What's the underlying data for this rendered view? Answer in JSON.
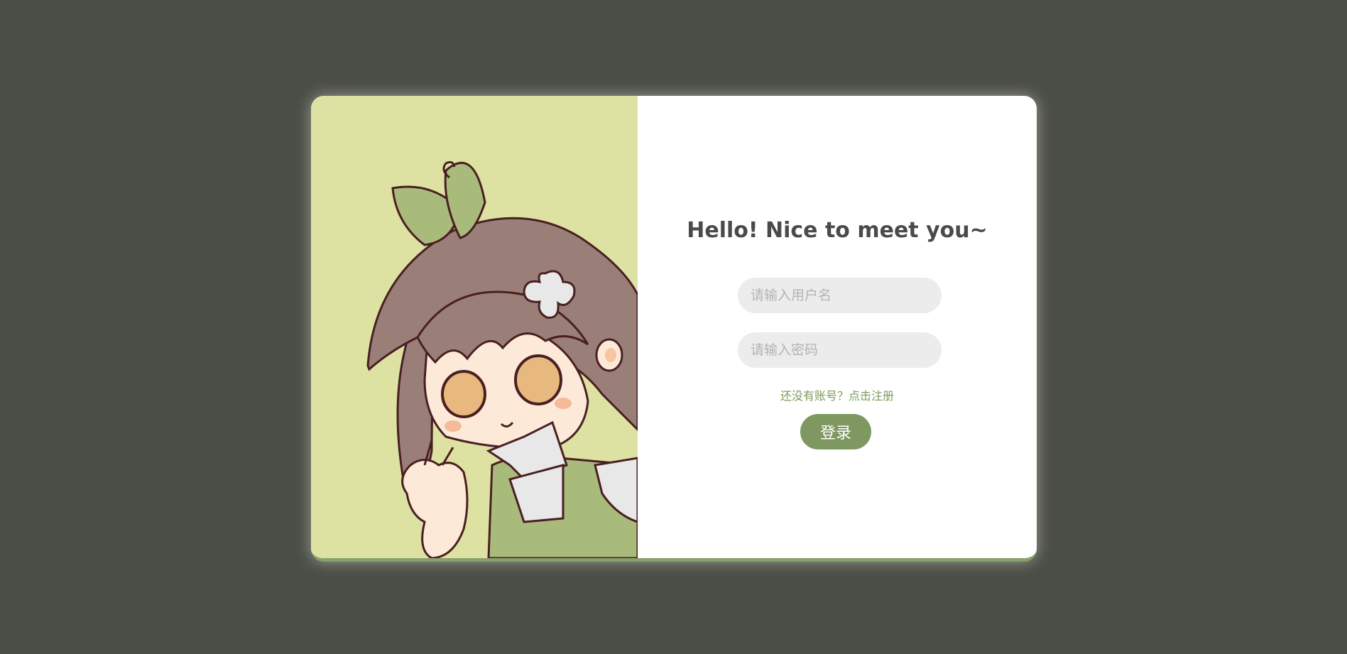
{
  "login": {
    "title": "Hello! Nice to meet you~",
    "username_placeholder": "请输入用户名",
    "password_placeholder": "请输入密码",
    "register_prompt": "还没有账号？点击注册",
    "login_button": "登录"
  },
  "illustration": {
    "name": "chibi-girl-with-leaf-illustration"
  },
  "colors": {
    "page_background": "#4b4e46",
    "illustration_background": "#dde2a3",
    "accent": "#7f9760",
    "link": "#7a9a5b",
    "input_background": "#ececec",
    "title_text": "#4a4a4a"
  }
}
